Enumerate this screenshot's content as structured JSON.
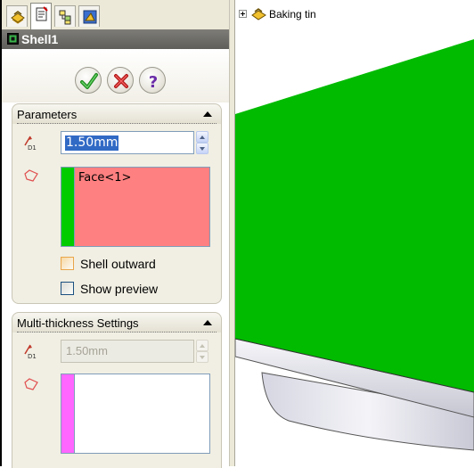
{
  "panel": {
    "tabs": [
      {
        "name": "FeatureManager design tree",
        "icon": "feature-tree-icon"
      },
      {
        "name": "PropertyManager",
        "icon": "property-manager-icon"
      },
      {
        "name": "ConfigurationManager",
        "icon": "configuration-manager-icon"
      },
      {
        "name": "DimXpertManager",
        "icon": "dimxpert-icon"
      }
    ],
    "title": "Shell1",
    "title_icon": "shell-feature-icon",
    "actions": {
      "ok": "ok-checkmark-icon",
      "cancel": "cancel-x-icon",
      "help": "help-question-icon"
    }
  },
  "parameters": {
    "title": "Parameters",
    "thickness_value": "1.50mm",
    "faces_to_remove": [
      "Face<1>"
    ],
    "selection_color": "#ff8080",
    "strip_color": "#00cc00",
    "shell_outward_label": "Shell outward",
    "shell_outward_checked": false,
    "show_preview_label": "Show preview",
    "show_preview_checked": false
  },
  "multi_thickness": {
    "title": "Multi-thickness Settings",
    "thickness_value": "1.50mm",
    "disabled": true,
    "strip_color": "#ff66ff"
  },
  "feature_tree": {
    "part_name": "Baking tin",
    "part_icon": "part-icon"
  },
  "colors": {
    "model_face": "#00bb00",
    "panel_background": "#f1efe3",
    "title_bar": "#6e6d69"
  }
}
